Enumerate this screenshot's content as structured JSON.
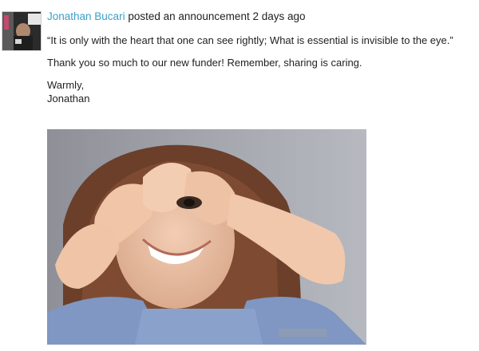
{
  "post": {
    "author": "Jonathan Bucari",
    "action": " posted an announcement ",
    "time_ago": "2 days ago",
    "quote": "“It is only with the heart that one can see rightly; What is essential is invisible to the eye.”",
    "thanks": "Thank you so much to our new funder! Remember, sharing is caring.",
    "closing": "Warmly,",
    "signature": "Jonathan"
  },
  "colors": {
    "link": "#3aa0c8",
    "text": "#1f1f1f"
  }
}
